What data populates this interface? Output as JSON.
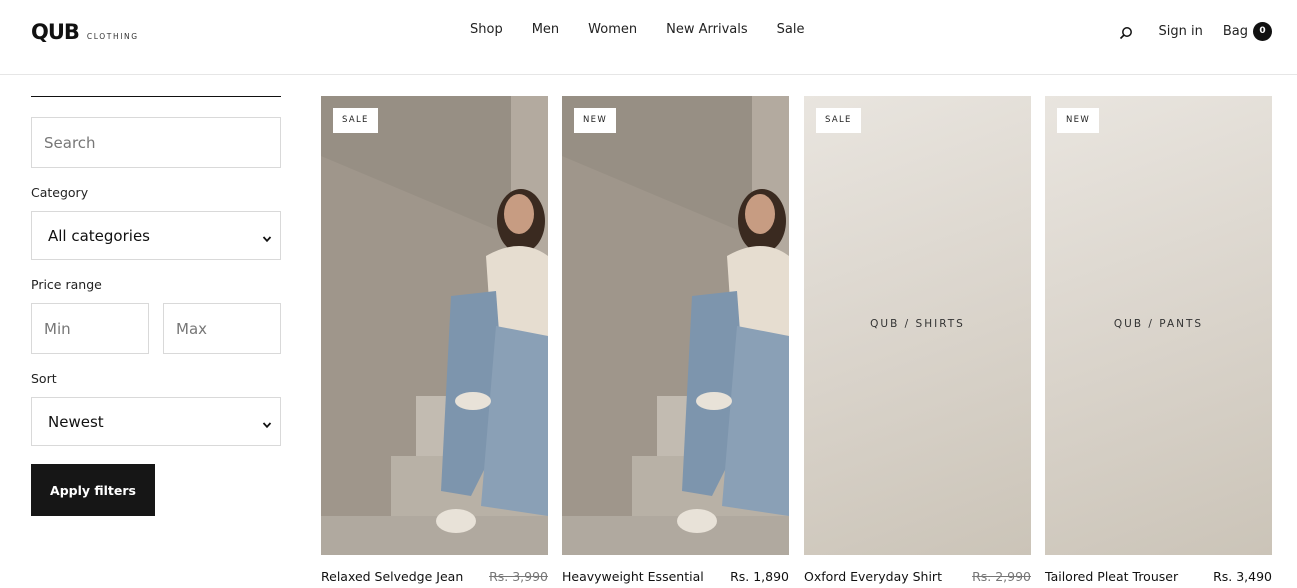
{
  "brand": {
    "name": "QUB",
    "tagline": "CLOTHING"
  },
  "nav": [
    "Shop",
    "Men",
    "Women",
    "New Arrivals",
    "Sale"
  ],
  "header": {
    "signin_label": "Sign in",
    "bag_label": "Bag",
    "bag_count": "0"
  },
  "filters": {
    "search_placeholder": "Search",
    "category_label": "Category",
    "category_value": "All categories",
    "price_label": "Price range",
    "min_placeholder": "Min",
    "max_placeholder": "Max",
    "sort_label": "Sort",
    "sort_value": "Newest",
    "apply_label": "Apply filters"
  },
  "products": [
    {
      "badge": "SALE",
      "name": "Relaxed Selvedge Jean",
      "price": "Rs. 3,990",
      "price_struck": true,
      "image": "photo",
      "placeholder": ""
    },
    {
      "badge": "NEW",
      "name": "Heavyweight Essential",
      "price": "Rs. 1,890",
      "price_struck": false,
      "image": "photo",
      "placeholder": ""
    },
    {
      "badge": "SALE",
      "name": "Oxford Everyday Shirt",
      "price": "Rs. 2,990",
      "price_struck": true,
      "image": "plain",
      "placeholder": "QUB / SHIRTS"
    },
    {
      "badge": "NEW",
      "name": "Tailored Pleat Trouser",
      "price": "Rs. 3,490",
      "price_struck": false,
      "image": "plain",
      "placeholder": "QUB / PANTS"
    }
  ]
}
